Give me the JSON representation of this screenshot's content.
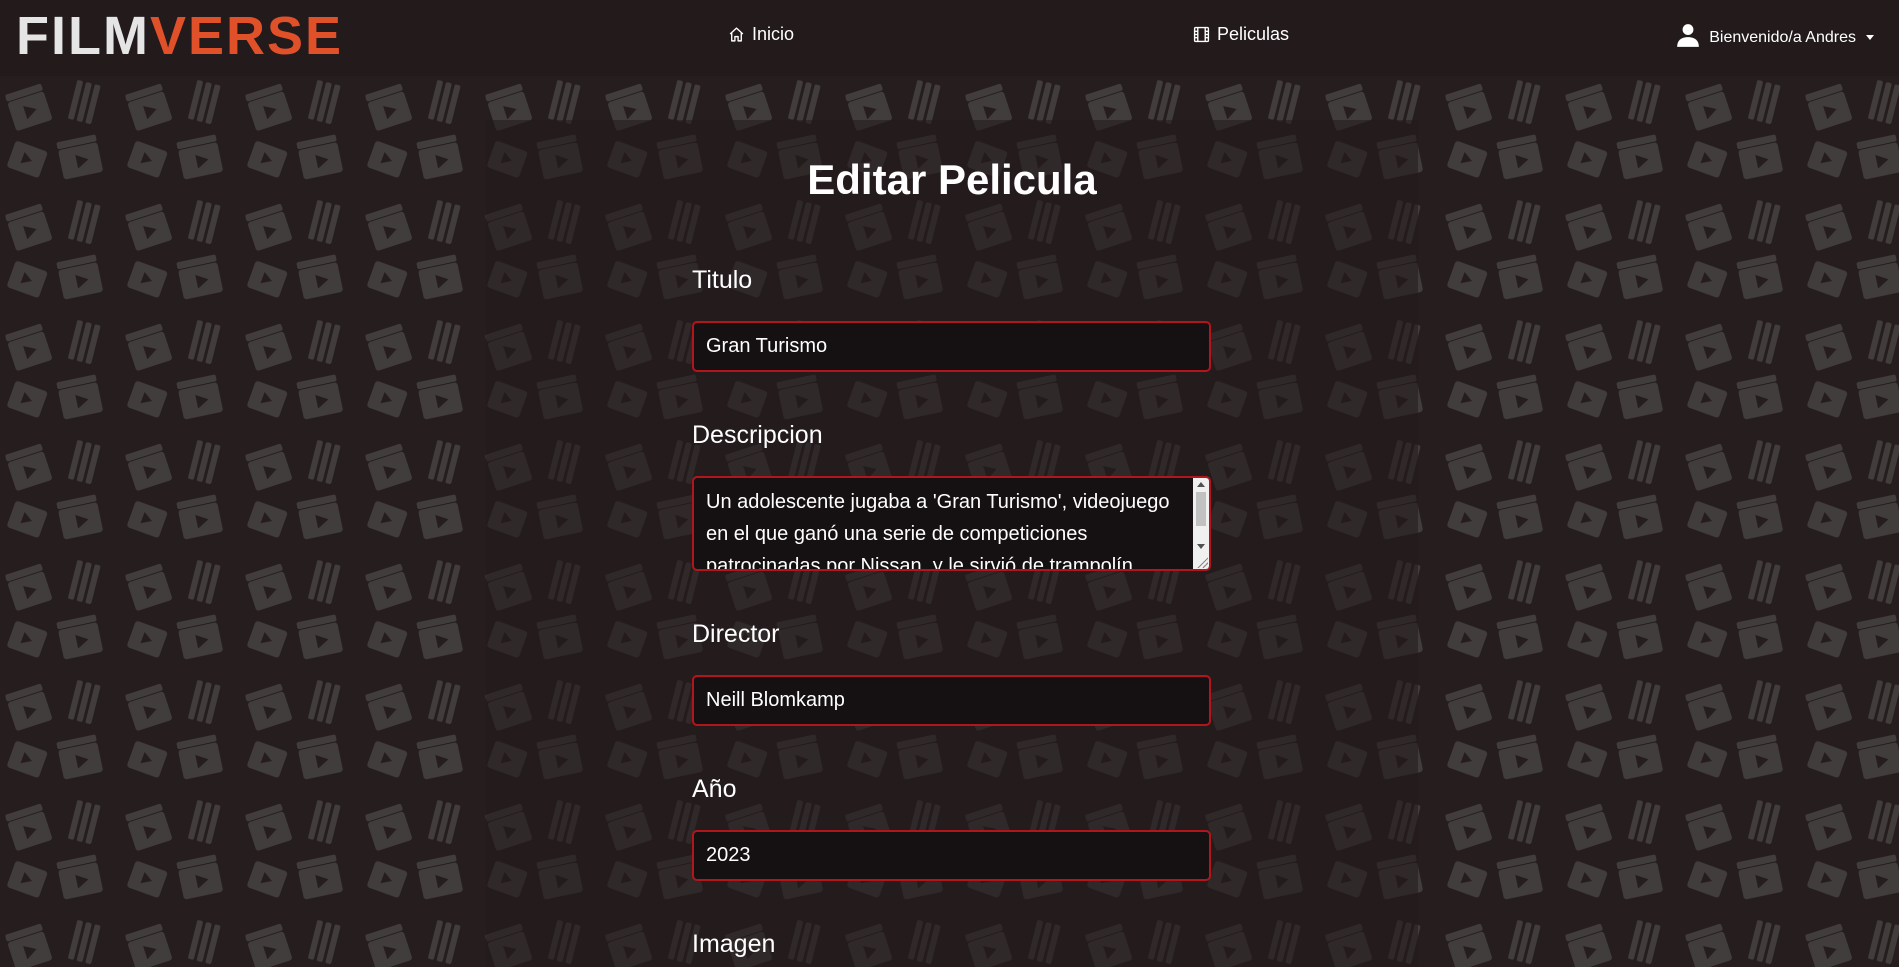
{
  "brand": {
    "part1": "FILM",
    "part2": "VERSE"
  },
  "nav": {
    "inicio": "Inicio",
    "peliculas": "Peliculas",
    "user": "Bienvenido/a Andres"
  },
  "form": {
    "title": "Editar Pelicula",
    "fields": {
      "titulo": {
        "label": "Titulo",
        "value": "Gran Turismo"
      },
      "descripcion": {
        "label": "Descripcion",
        "value": "Un adolescente jugaba a 'Gran Turismo', videojuego en el que ganó una serie de competiciones patrocinadas por Nissan, y le sirvió de trampolín"
      },
      "director": {
        "label": "Director",
        "value": "Neill Blomkamp"
      },
      "anio": {
        "label": "Año",
        "value": "2023"
      },
      "imagen": {
        "label": "Imagen"
      }
    }
  },
  "colors": {
    "brand_light": "#e5e5e5",
    "brand_accent": "#e0512a",
    "input_border": "#b3151c",
    "input_bg": "#151112",
    "navbar_bg": "#221a1b"
  },
  "icons": {
    "inicio": "home-icon",
    "peliculas": "film-icon",
    "user": "user-icon"
  }
}
